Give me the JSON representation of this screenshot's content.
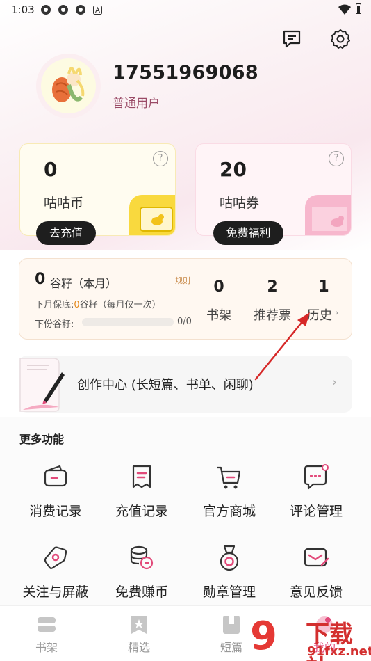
{
  "status_bar": {
    "time": "1:03"
  },
  "profile": {
    "phone": "17551969068",
    "level": "普通用户"
  },
  "cards": {
    "coin": {
      "value": "0",
      "label": "咕咕币",
      "button": "去充值"
    },
    "ticket": {
      "value": "20",
      "label": "咕咕券",
      "button": "免费福利"
    }
  },
  "grain": {
    "value": "0",
    "title": "谷籽（本月）",
    "rule": "规则",
    "guarantee_prefix": "下月保底:",
    "guarantee_value": "0",
    "guarantee_suffix": "谷籽（每月仅一次）",
    "next_label": "下份谷籽:",
    "next_ratio": "0/0",
    "progress": 0
  },
  "stats": [
    {
      "value": "0",
      "label": "书架"
    },
    {
      "value": "2",
      "label": "推荐票"
    },
    {
      "value": "1",
      "label": "历史"
    }
  ],
  "create_center": {
    "label": "创作中心 (长短篇、书单、闲聊)"
  },
  "more": {
    "title": "更多功能",
    "items": [
      {
        "label": "消费记录",
        "icon": "wallet-icon"
      },
      {
        "label": "充值记录",
        "icon": "receipt-icon"
      },
      {
        "label": "官方商城",
        "icon": "cart-icon"
      },
      {
        "label": "评论管理",
        "icon": "comment-icon"
      },
      {
        "label": "关注与屏蔽",
        "icon": "tag-icon"
      },
      {
        "label": "免费赚币",
        "icon": "coins-icon"
      },
      {
        "label": "勋章管理",
        "icon": "medal-icon"
      },
      {
        "label": "意见反馈",
        "icon": "feedback-icon"
      }
    ]
  },
  "nav": [
    {
      "label": "书架",
      "icon": "bookshelf-icon"
    },
    {
      "label": "精选",
      "icon": "featured-icon"
    },
    {
      "label": "短篇",
      "icon": "short-story-icon"
    },
    {
      "label": "我的",
      "icon": "mine-icon"
    }
  ],
  "watermark": {
    "big": "9",
    "text": "下载站",
    "url": "91fxz.net"
  },
  "colors": {
    "accent_pink": "#e24a7a",
    "pill_dark": "#1e1e1e",
    "arrow_red": "#d62828"
  }
}
